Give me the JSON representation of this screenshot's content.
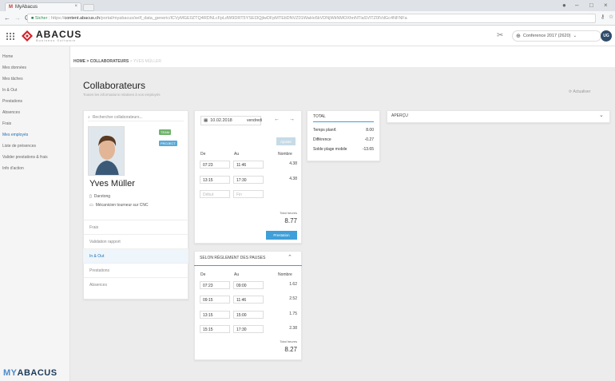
{
  "browser": {
    "tab_title": "MyAbacus",
    "security": "Sicher",
    "scheme": "https://",
    "host": "content.abacus.ch",
    "path": "/portal/myabacus/self_data_generic/ICVyMGE0ZTQ4RDNLcFpLdW9DRT5YSEI3QjlwDFpMTEtiDNVZ01WaHo5kVDNjWkNMOXhnNTlaSVlTZ0lVdGc4NFNFa"
  },
  "header": {
    "logo": "ABACUS",
    "logo_sub": "Business Software",
    "conference": "Conference 2017 (2620)",
    "avatar_initials": "UG"
  },
  "sidebar": {
    "items": [
      "Home",
      "Mes données",
      "Mes tâches",
      "In & Out",
      "Prestations",
      "Absences",
      "Frais",
      "Mes employés",
      "Liste de présences",
      "Valider prestations & frais",
      "Info d'action"
    ],
    "active_index": 7,
    "bottom_logo_a": "MY",
    "bottom_logo_b": "ABACUS"
  },
  "breadcrumb": {
    "home": "HOME",
    "sep": ">",
    "section": "COLLABORATEURS",
    "current": "YVES MÜLLER"
  },
  "page": {
    "title": "Collaborateurs",
    "subtitle": "Toutes les informations relatives à vos employés",
    "actions": "Actualiser"
  },
  "profile": {
    "search_placeholder": "Rechercher collaborateurs...",
    "badges": [
      "TEAM",
      "PROJECT"
    ],
    "name": "Yves Müller",
    "info": [
      "Darstong",
      "Mécanicien tourneur sur CNC"
    ],
    "links": [
      "Frais",
      "Validation rapport",
      "In & Out",
      "Prestations",
      "Absences"
    ],
    "active_link": 2
  },
  "stamp": {
    "date": "10.02.2018",
    "day": "vendredi",
    "adjust_btn": "Ajuster",
    "col_from": "De",
    "col_to": "Au",
    "col_num": "Nombre",
    "rows": [
      {
        "from": "07:23",
        "to": "11:46",
        "num": "4.38"
      },
      {
        "from": "13:15",
        "to": "17:30",
        "num": "4.38"
      }
    ],
    "empty_from": "Début",
    "empty_to": "Fin",
    "total_label": "Total heures",
    "total": "8.77",
    "button": "Prestation"
  },
  "selon": {
    "header": "SELON RÈGLEMENT DES PAUSES",
    "col_from": "De",
    "col_to": "Au",
    "col_num": "Nombre",
    "rows": [
      {
        "from": "07:23",
        "to": "09:00",
        "num": "1.62"
      },
      {
        "from": "09:15",
        "to": "11:46",
        "num": "2.52"
      },
      {
        "from": "13:15",
        "to": "15:00",
        "num": "1.75"
      },
      {
        "from": "15:15",
        "to": "17:30",
        "num": "2.38"
      }
    ],
    "total_label": "Total heures",
    "total": "8.27"
  },
  "total": {
    "title": "TOTAL",
    "rows": [
      {
        "label": "Temps planif.",
        "value": "8.00"
      },
      {
        "label": "Différence",
        "value": "-0.27"
      },
      {
        "label": "Solde plage mobile",
        "value": "-13.65"
      }
    ]
  },
  "apercu": {
    "title": "APERÇU"
  },
  "colors": {
    "accent": "#3f9fd8",
    "brand": "#1b3a5a",
    "active_bg": "#eef5fb"
  }
}
